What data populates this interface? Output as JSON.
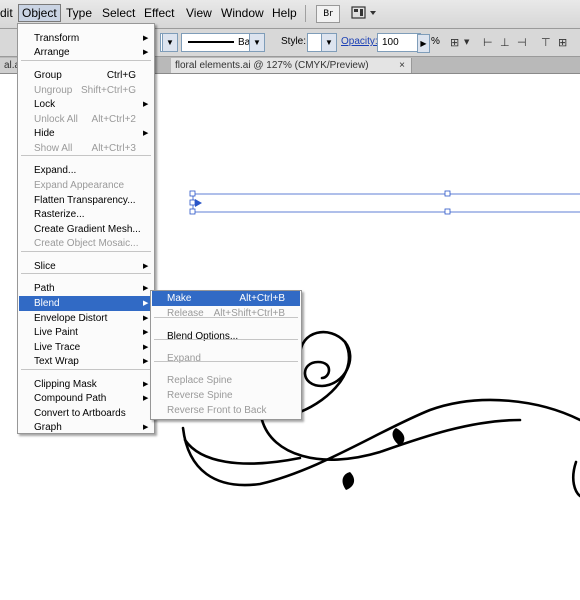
{
  "menubar": {
    "items": [
      "dit",
      "Object",
      "Type",
      "Select",
      "Effect",
      "View",
      "Window",
      "Help"
    ],
    "bridge_label": "Br",
    "workspace_icon": "workspace-grid-icon"
  },
  "control_bar": {
    "stroke_style": "Basic",
    "style_label": "Style:",
    "opacity_label": "Opacity:",
    "opacity_value": "100",
    "percent": "%"
  },
  "tabs": [
    {
      "label": "al.ai",
      "close": "×"
    },
    {
      "label": "floral elements.ai @ 127% (CMYK/Preview)",
      "close": "×"
    }
  ],
  "object_menu": [
    {
      "label": "Transform",
      "sub": true
    },
    {
      "label": "Arrange",
      "sub": true
    },
    {
      "label": "Group",
      "shortcut": "Ctrl+G"
    },
    {
      "label": "Ungroup",
      "shortcut": "Shift+Ctrl+G",
      "disabled": true
    },
    {
      "label": "Lock",
      "sub": true
    },
    {
      "label": "Unlock All",
      "shortcut": "Alt+Ctrl+2",
      "disabled": true
    },
    {
      "label": "Hide",
      "sub": true
    },
    {
      "label": "Show All",
      "shortcut": "Alt+Ctrl+3",
      "disabled": true
    },
    {
      "label": "Expand..."
    },
    {
      "label": "Expand Appearance",
      "disabled": true
    },
    {
      "label": "Flatten Transparency..."
    },
    {
      "label": "Rasterize..."
    },
    {
      "label": "Create Gradient Mesh..."
    },
    {
      "label": "Create Object Mosaic...",
      "disabled": true
    },
    {
      "label": "Slice",
      "sub": true
    },
    {
      "label": "Path",
      "sub": true
    },
    {
      "label": "Blend",
      "sub": true,
      "highlighted": true
    },
    {
      "label": "Envelope Distort",
      "sub": true
    },
    {
      "label": "Live Paint",
      "sub": true
    },
    {
      "label": "Live Trace",
      "sub": true
    },
    {
      "label": "Text Wrap",
      "sub": true
    },
    {
      "label": "Clipping Mask",
      "sub": true
    },
    {
      "label": "Compound Path",
      "sub": true
    },
    {
      "label": "Convert to Artboards"
    },
    {
      "label": "Graph",
      "sub": true
    }
  ],
  "blend_menu": [
    {
      "label": "Make",
      "shortcut": "Alt+Ctrl+B",
      "highlighted": true
    },
    {
      "label": "Release",
      "shortcut": "Alt+Shift+Ctrl+B",
      "disabled": true
    },
    {
      "label": "Blend Options..."
    },
    {
      "label": "Expand",
      "disabled": true
    },
    {
      "label": "Replace Spine",
      "disabled": true
    },
    {
      "label": "Reverse Spine",
      "disabled": true
    },
    {
      "label": "Reverse Front to Back",
      "disabled": true
    }
  ],
  "colors": {
    "highlight": "#316ac5",
    "disabled_text": "#9a9a9a",
    "selection": "#2a55c8"
  }
}
